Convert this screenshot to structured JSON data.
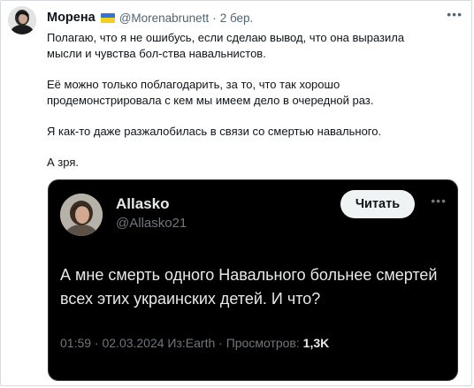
{
  "tweet": {
    "author_name": "Морена",
    "flag_icon": "ukraine-flag-icon",
    "handle": "@Morenabrunett",
    "separator": "·",
    "date": "2 бер.",
    "more_icon": "more-horizontal-icon",
    "text": [
      "Полагаю, что я не ошибусь, если сделаю вывод, что она выразила",
      "мысли и чувства бол-ства навальнистов.",
      "Её можно только поблагодарить, за то, что так хорошо",
      "продемонстрировала с кем мы имеем дело в очередной раз.",
      "Я как-то даже разжалобилась в связи со смертью навального.",
      "А зря."
    ]
  },
  "quoted": {
    "author_name": "Allasko",
    "handle": "@Allasko21",
    "follow_label": "Читать",
    "more_icon": "more-horizontal-icon",
    "text": "А мне смерть одного Навального больнее смертей всех этих украинских детей. И что?",
    "meta_prefix": "01:59 · 02.03.2024 Из:Earth · Просмотров: ",
    "views": "1,3K"
  },
  "colors": {
    "flag_blue": "#2f74d6",
    "flag_yellow": "#f5cf1d",
    "card_bg": "#000000",
    "muted": "#536471"
  }
}
